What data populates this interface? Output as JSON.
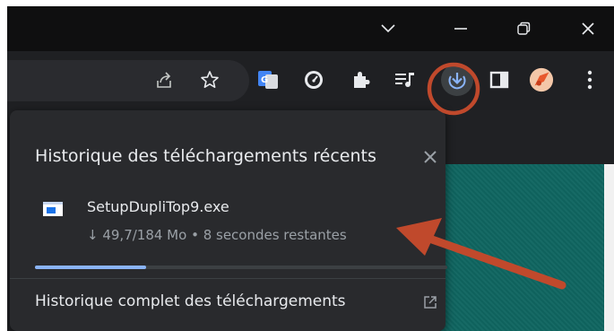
{
  "window_controls": {
    "tab_search_icon": "chevron-down-icon",
    "minimize_icon": "minimize-icon",
    "restore_icon": "restore-icon",
    "close_icon": "close-icon"
  },
  "toolbar": {
    "icons": [
      "share-icon",
      "star-icon",
      "google-translate-icon",
      "speed-gauge-icon",
      "extensions-puzzle-icon",
      "media-queue-icon",
      "download-icon",
      "side-panel-icon",
      "profile-avatar-icon",
      "more-menu-icon"
    ]
  },
  "download_panel": {
    "title": "Historique des téléchargements récents",
    "close_icon": "close-icon",
    "item": {
      "filename": "SetupDupliTop9.exe",
      "status": "↓ 49,7/184 Mo • 8 secondes restantes",
      "progress": 0.27
    },
    "full_history_label": "Historique complet des téléchargements",
    "open_external_icon": "open-in-new-icon"
  },
  "colors": {
    "accent": "#8ab4f8",
    "annotation": "#c0492c",
    "page_teal": "#0f6560"
  }
}
